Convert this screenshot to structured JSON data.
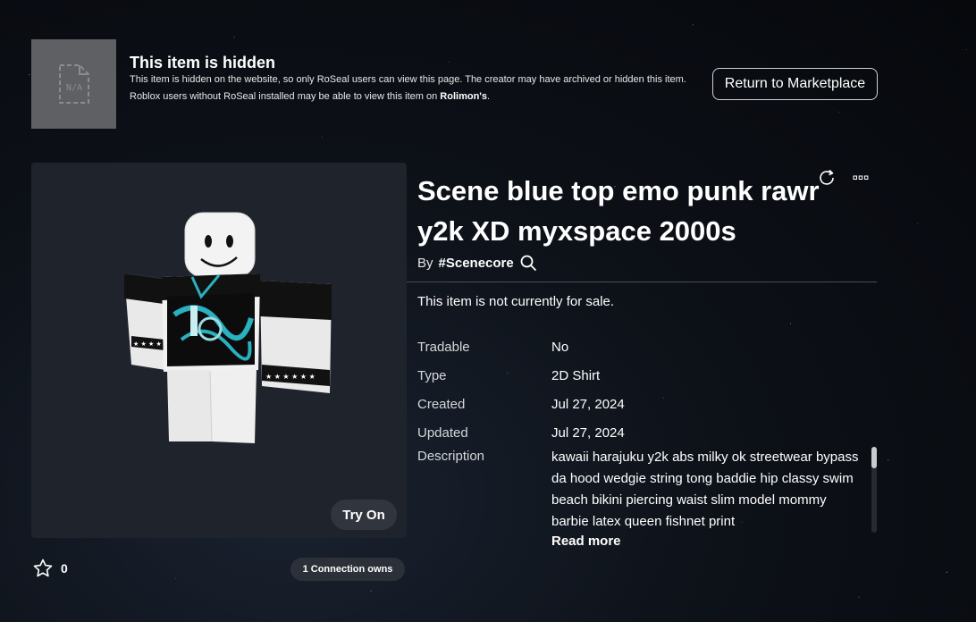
{
  "banner": {
    "thumb_label": "N/A",
    "title": "This item is hidden",
    "line1": "This item is hidden on the website, so only RoSeal users can view this page. The creator may have archived or hidden this item.",
    "line2_prefix": "Roblox users without RoSeal installed may be able to view this item on ",
    "line2_link": "Rolimon's",
    "line2_suffix": ".",
    "return_button": "Return to Marketplace"
  },
  "item": {
    "title": "Scene blue top emo punk rawr y2k XD myxspace 2000s",
    "creator_by": "By",
    "creator_name": "#Scenecore",
    "sale_status": "This item is not currently for sale.",
    "try_on": "Try On",
    "favorites": "0",
    "connections": "1 Connection owns"
  },
  "details": [
    {
      "label": "Tradable",
      "value": "No"
    },
    {
      "label": "Type",
      "value": "2D Shirt"
    },
    {
      "label": "Created",
      "value": "Jul 27, 2024"
    },
    {
      "label": "Updated",
      "value": "Jul 27, 2024"
    }
  ],
  "description": {
    "label": "Description",
    "text": "kawaii harajuku y2k abs milky ok streetwear bypass da hood wedgie string tong baddie hip classy swim beach bikini piercing waist slim model mommy barbie latex queen fishnet print",
    "read_more": "Read more",
    "scroll_fraction": 0
  },
  "icons": {
    "thumb": "file-na-icon",
    "creator": "search-icon",
    "refresh": "refresh-icon",
    "more": "more-icon",
    "favorite": "star-icon"
  },
  "colors": {
    "accent": "#2ab0bf",
    "panel": "#1f232b",
    "button": "#31353d"
  }
}
